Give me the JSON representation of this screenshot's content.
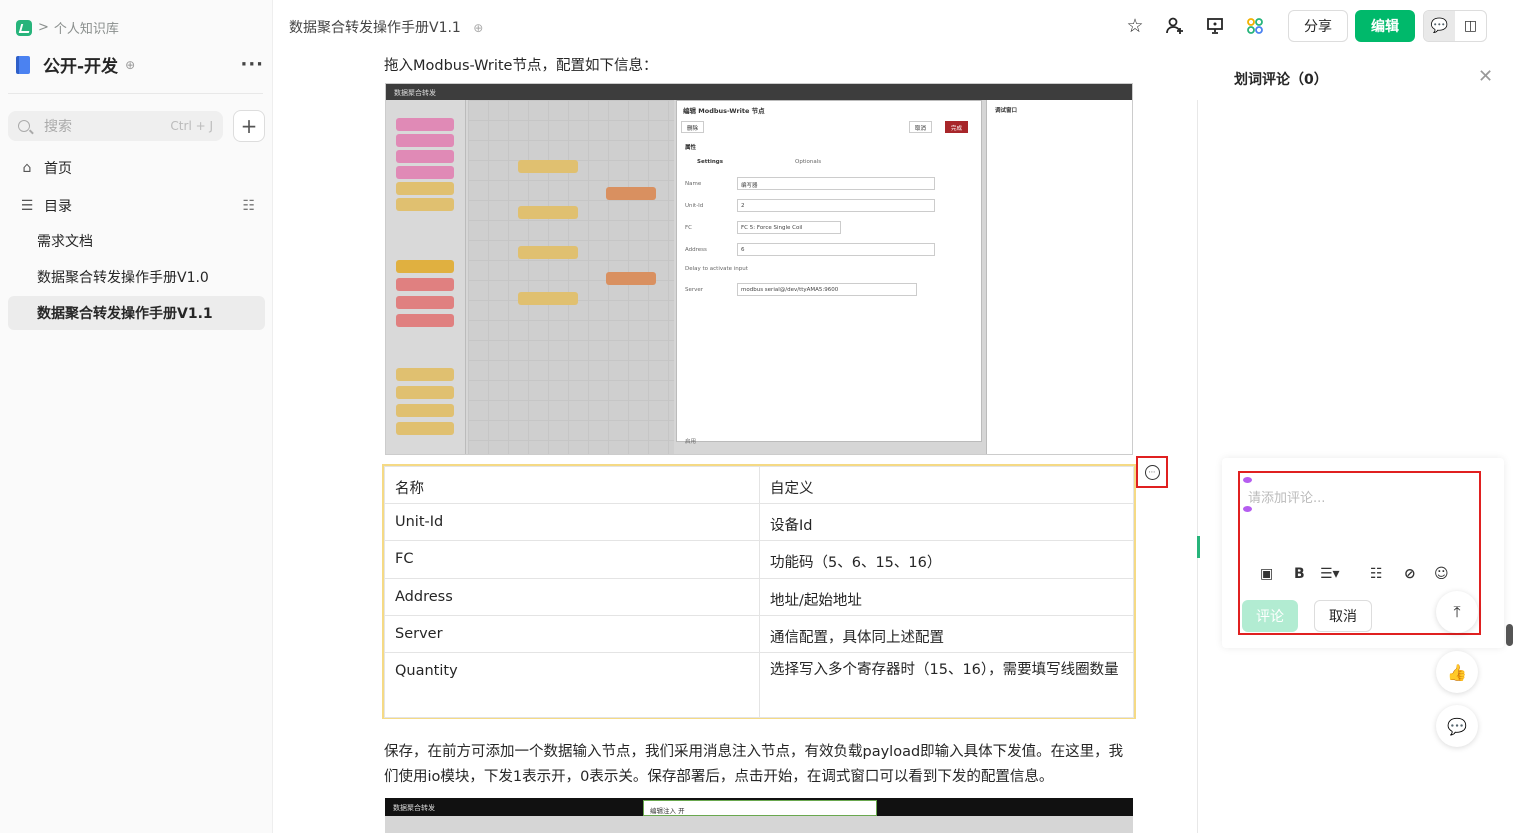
{
  "breadcrumb": {
    "separator": ">",
    "label": "个人知识库"
  },
  "book": {
    "title": "公开-开发",
    "more": "···"
  },
  "search": {
    "placeholder": "搜索",
    "shortcut": "Ctrl + J",
    "add": "+"
  },
  "nav": {
    "home": "首页",
    "toc": "目录"
  },
  "docs": [
    "需求文档",
    "数据聚合转发操作手册V1.0",
    "数据聚合转发操作手册V1.1"
  ],
  "header": {
    "title": "数据聚合转发操作手册V1.1",
    "share": "分享",
    "edit": "编辑"
  },
  "icons": {
    "star": "star-icon",
    "add_user": "add-user-icon",
    "present": "present-icon",
    "apps": "apps-icon",
    "comment": "comment-icon",
    "layout": "layout-icon"
  },
  "content": {
    "intro": "拖入Modbus-Write节点，配置如下信息：",
    "screenshot1": {
      "window_title": "数据聚合转发",
      "dialog_title": "编辑 Modbus-Write 节点",
      "delete": "删除",
      "cancel": "取消",
      "done": "完成",
      "props": "属性",
      "tab_settings": "Settings",
      "tab_optionals": "Optionals",
      "fields": [
        {
          "label": "Name",
          "value": "编写器"
        },
        {
          "label": "Unit-Id",
          "value": "2"
        },
        {
          "label": "FC",
          "value": "FC 5: Force Single Coil"
        },
        {
          "label": "Address",
          "value": "6"
        },
        {
          "label": "Delay to activate input",
          "value": ""
        },
        {
          "label": "Server",
          "value": "modbus serial@/dev/ttyAMA5:9600"
        }
      ],
      "debug": "调试窗口",
      "enabled": "启用"
    },
    "table": [
      [
        "名称",
        "自定义"
      ],
      [
        "Unit-Id",
        "设备Id"
      ],
      [
        "FC",
        "功能码（5、6、15、16）"
      ],
      [
        "Address",
        "地址/起始地址"
      ],
      [
        "Server",
        "通信配置，具体同上述配置"
      ],
      [
        "Quantity",
        "选择写入多个寄存器时（15、16），需要填写线圈数量"
      ]
    ],
    "para": "保存，在前方可添加一个数据输入节点，我们采用消息注入节点，有效负载payload即输入具体下发值。在这里，我们使用io模块，下发1表示开，0表示关。保存部署后，点击开始，在调式窗口可以看到下发的配置信息。",
    "screenshot2": {
      "window_title": "数据聚合转发",
      "annotation": "编辑注入 开"
    }
  },
  "panel": {
    "title": "划词评论（0）",
    "placeholder": "请添加评论...",
    "submit": "评论",
    "cancel": "取消"
  },
  "colors": {
    "accent": "#00b96b",
    "highlight": "#f5da85",
    "annotation": "#e02020"
  }
}
